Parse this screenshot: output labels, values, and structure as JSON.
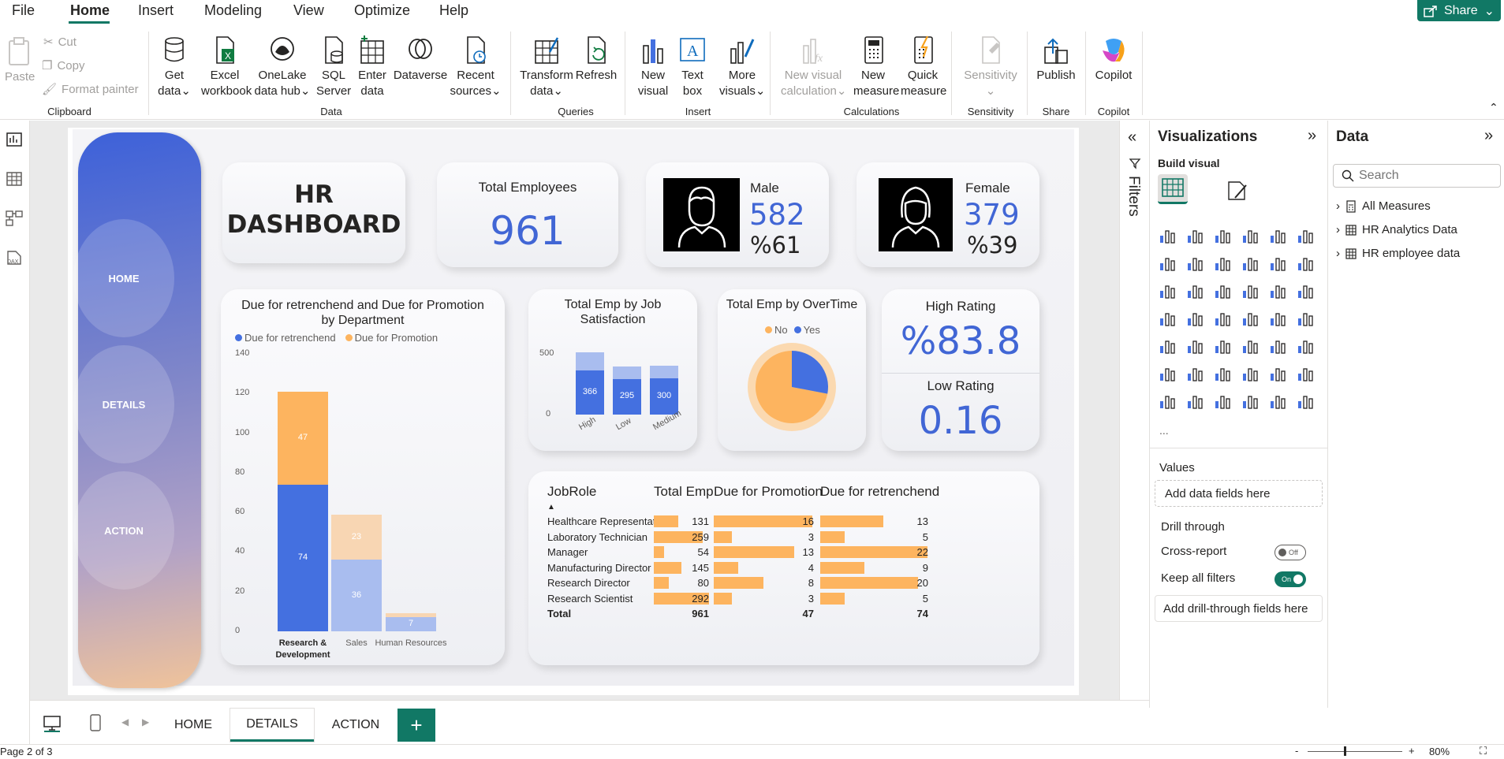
{
  "menu": [
    "File",
    "Home",
    "Insert",
    "Modeling",
    "View",
    "Optimize",
    "Help"
  ],
  "share_label": "Share",
  "ribbon": {
    "clipboard": {
      "paste": "Paste",
      "cut": "Cut",
      "copy": "Copy",
      "format_painter": "Format painter",
      "group": "Clipboard"
    },
    "data": {
      "get_data": [
        "Get",
        "data"
      ],
      "excel": [
        "Excel",
        "workbook"
      ],
      "onelake": [
        "OneLake",
        "data hub"
      ],
      "sql": [
        "SQL",
        "Server"
      ],
      "enter": [
        "Enter",
        "data"
      ],
      "dataverse": [
        "Dataverse",
        ""
      ],
      "recent": [
        "Recent",
        "sources"
      ],
      "group": "Data"
    },
    "queries": {
      "transform": [
        "Transform",
        "data"
      ],
      "refresh": [
        "Refresh",
        ""
      ],
      "group": "Queries"
    },
    "insert": {
      "new_visual": [
        "New",
        "visual"
      ],
      "text_box": [
        "Text",
        "box"
      ],
      "more_visuals": [
        "More",
        "visuals"
      ],
      "group": "Insert"
    },
    "calculations": {
      "new_visual_calc": [
        "New visual",
        "calculation"
      ],
      "new_measure": [
        "New",
        "measure"
      ],
      "quick_measure": [
        "Quick",
        "measure"
      ],
      "group": "Calculations"
    },
    "sensitivity": {
      "label": "Sensitivity",
      "group": "Sensitivity"
    },
    "share": {
      "publish": "Publish",
      "group": "Share"
    },
    "copilot": {
      "label": "Copilot",
      "group": "Copilot"
    }
  },
  "dashboard": {
    "nav": {
      "home": "HOME",
      "details": "DETAILS",
      "action": "ACTION"
    },
    "title_line1": "HR",
    "title_line2": "DASHBOARD",
    "total_employees": {
      "label": "Total Employees",
      "value": "961"
    },
    "male": {
      "label": "Male",
      "count": "582",
      "pct": "%61"
    },
    "female": {
      "label": "Female",
      "count": "379",
      "pct": "%39"
    },
    "high_rating": {
      "label": "High Rating",
      "value": "%83.8"
    },
    "low_rating": {
      "label": "Low Rating",
      "value": "0.16"
    },
    "overtime": {
      "title": "Total Emp by OverTime",
      "legend": [
        "No",
        "Yes"
      ]
    }
  },
  "chart_data": [
    {
      "type": "bar",
      "title": "Due for retrenchend and Due for Promotion by Department",
      "stacked": true,
      "categories": [
        "Research & Development",
        "Sales",
        "Human Resources"
      ],
      "series": [
        {
          "name": "Due for retrenchend",
          "values": [
            74,
            36,
            7
          ],
          "color": "#4470e0"
        },
        {
          "name": "Due for Promotion",
          "values": [
            47,
            23,
            2
          ],
          "color": "#fdb45f"
        }
      ],
      "ylim": [
        0,
        140
      ],
      "yticks": [
        0,
        20,
        40,
        60,
        80,
        100,
        120,
        140
      ]
    },
    {
      "type": "bar",
      "title": "Total Emp by Job Satisfaction",
      "stacked": true,
      "categories": [
        "High",
        "Low",
        "Medium"
      ],
      "series": [
        {
          "values": [
            366,
            295,
            300
          ]
        },
        {
          "values": [
            150,
            100,
            100
          ]
        }
      ],
      "yticks": [
        0,
        500
      ]
    },
    {
      "type": "pie",
      "title": "Total Emp by OverTime",
      "series": [
        {
          "name": "No",
          "value": 72
        },
        {
          "name": "Yes",
          "value": 28
        }
      ]
    },
    {
      "type": "table",
      "headers": [
        "JobRole",
        "Total Emp",
        "Due for Promotion",
        "Due for retrenchend"
      ],
      "rows": [
        {
          "role": "Healthcare Representative",
          "total": 131,
          "promotion": 16,
          "retrench": 13
        },
        {
          "role": "Laboratory Technician",
          "total": 259,
          "promotion": 3,
          "retrench": 5
        },
        {
          "role": "Manager",
          "total": 54,
          "promotion": 13,
          "retrench": 22
        },
        {
          "role": "Manufacturing Director",
          "total": 145,
          "promotion": 4,
          "retrench": 9
        },
        {
          "role": "Research Director",
          "total": 80,
          "promotion": 8,
          "retrench": 20
        },
        {
          "role": "Research Scientist",
          "total": 292,
          "promotion": 3,
          "retrench": 5
        }
      ],
      "total_label": "Total",
      "totals": {
        "total": 961,
        "promotion": 47,
        "retrench": 74
      }
    }
  ],
  "filters_label": "Filters",
  "viz_pane": {
    "title": "Visualizations",
    "build_visual": "Build visual",
    "values": "Values",
    "add_fields": "Add data fields here",
    "drill_through": "Drill through",
    "cross_report": "Cross-report",
    "cross_state": "Off",
    "keep_filters": "Keep all filters",
    "keep_state": "On",
    "add_drill": "Add drill-through fields here",
    "more": "..."
  },
  "data_pane": {
    "title": "Data",
    "search_placeholder": "Search",
    "items": [
      "All Measures",
      "HR Analytics Data",
      "HR employee data"
    ]
  },
  "tabs": [
    "HOME",
    "DETAILS",
    "ACTION"
  ],
  "active_tab": "DETAILS",
  "status": {
    "page": "Page 2 of 3",
    "zoom": "80%"
  }
}
